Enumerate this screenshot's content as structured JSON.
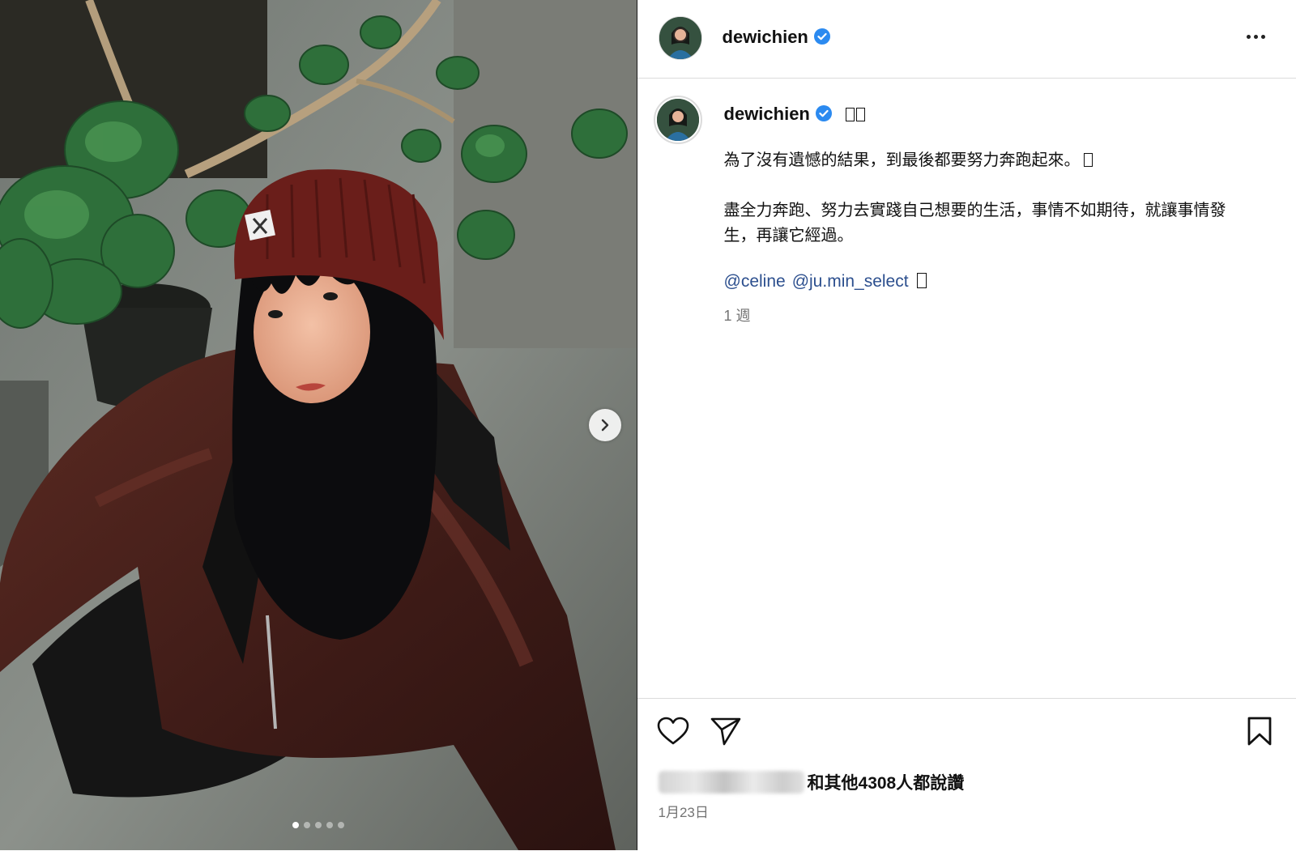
{
  "post": {
    "username": "dewichien",
    "verified": true,
    "caption": {
      "emoji_suffix": "",
      "line1": "為了沒有遺憾的結果，到最後都要努力奔跑起來。",
      "line2": "盡全力奔跑、努力去實踐自己想要的生活，事情不如期待，就讓事情發生，再讓它經過。",
      "mentions": [
        "@celine",
        "@ju.min_select"
      ],
      "relative_time": "1 週"
    },
    "carousel": {
      "total": 5,
      "active": 1
    },
    "likes_text": "和其他4308人都說讚",
    "date": "1月23日"
  },
  "icons": {
    "more": "more-options-icon",
    "verified": "verified-badge-icon",
    "like": "heart-icon",
    "share": "send-icon",
    "save": "bookmark-icon",
    "next": "chevron-right-icon"
  },
  "colors": {
    "verified_blue": "#2b8af0",
    "mention_blue": "#2c4f8e",
    "muted": "#737373",
    "divider": "#dbdbdb"
  }
}
